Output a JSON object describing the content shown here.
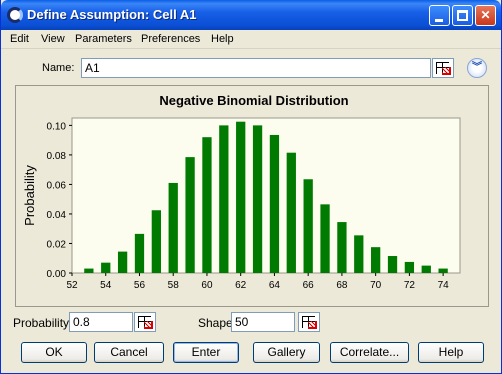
{
  "window": {
    "title": "Define Assumption: Cell A1"
  },
  "menu": [
    "Edit",
    "View",
    "Parameters",
    "Preferences",
    "Help"
  ],
  "name_row": {
    "label": "Name:",
    "value": "A1"
  },
  "params": {
    "probability_label": "Probability",
    "probability_value": "0.8",
    "shape_label": "Shape",
    "shape_value": "50"
  },
  "buttons": {
    "ok": "OK",
    "cancel": "Cancel",
    "enter": "Enter",
    "gallery": "Gallery",
    "correlate": "Correlate...",
    "help": "Help"
  },
  "chart_data": {
    "type": "bar",
    "title": "Negative Binomial Distribution",
    "ylabel": "Probability",
    "xlabel": "",
    "bar_color": "#007a00",
    "background": "#fcfcef",
    "x_ticks": [
      "52",
      "54",
      "56",
      "58",
      "60",
      "62",
      "64",
      "66",
      "68",
      "70",
      "72",
      "74"
    ],
    "y_ticks": [
      "0.00",
      "0.02",
      "0.04",
      "0.06",
      "0.08",
      "0.10"
    ],
    "xlim": [
      52,
      75
    ],
    "ylim": [
      0,
      0.105
    ],
    "x": [
      53,
      54,
      55,
      56,
      57,
      58,
      59,
      60,
      61,
      62,
      63,
      64,
      65,
      66,
      67,
      68,
      69,
      70,
      71,
      72,
      73,
      74
    ],
    "values": [
      0.003,
      0.007,
      0.0145,
      0.0265,
      0.0425,
      0.061,
      0.0785,
      0.092,
      0.1,
      0.1025,
      0.1,
      0.0935,
      0.0815,
      0.0635,
      0.0465,
      0.0345,
      0.0255,
      0.0175,
      0.0115,
      0.0075,
      0.005,
      0.003
    ]
  }
}
